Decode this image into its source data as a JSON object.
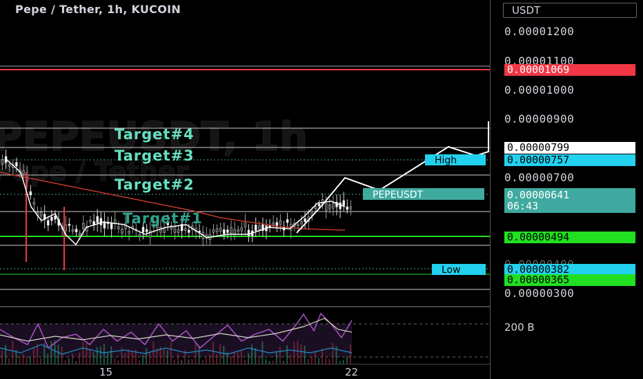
{
  "header": {
    "title": "Pepe / Tether, 1h, KUCOIN"
  },
  "watermark": {
    "line1": "PEPEUSDT, 1h",
    "line2": "Pepe / Tether"
  },
  "axis": {
    "currency": "USDT",
    "ticks": [
      "0.00001200",
      "0.00001100",
      "0.00001000",
      "0.00000900",
      "0.00000700",
      "0.00000400",
      "0.00000300"
    ],
    "volume_label": "200 B"
  },
  "tags": {
    "red": {
      "value": "0.00001069",
      "color": "#f23645"
    },
    "white": {
      "value": "0.00000799",
      "color": "#ffffff"
    },
    "high": {
      "label": "High",
      "value": "0.00000757",
      "color": "#22d1ee"
    },
    "pepe": {
      "label": "PEPEUSDT",
      "value": "0.00000641",
      "countdown": "06:43",
      "color": "#3fa99f"
    },
    "green1": {
      "value": "0.00000494",
      "color": "#21e021"
    },
    "low": {
      "label": "Low",
      "value": "0.00000382",
      "color": "#22d1ee"
    },
    "green2": {
      "value": "0.00000365",
      "color": "#21e021"
    }
  },
  "targets": [
    "Target#4",
    "Target#3",
    "Target#2",
    "Target#1"
  ],
  "time_axis": {
    "ticks": [
      "15",
      "22"
    ]
  },
  "colors": {
    "accent": "#66e0c2",
    "red_line": "#f23645",
    "green_line": "#21e021",
    "rsi": "#a34fbf"
  }
}
